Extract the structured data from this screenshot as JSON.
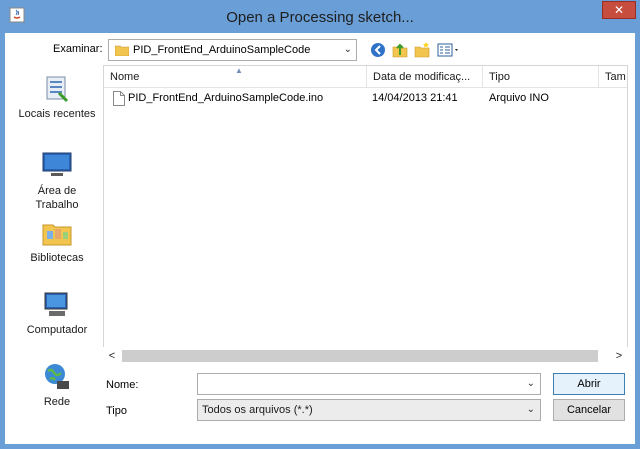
{
  "window": {
    "title": "Open a Processing sketch...",
    "close_label": "✕"
  },
  "toolbar": {
    "lookin_label": "Examinar:",
    "lookin_value": "PID_FrontEnd_ArduinoSampleCode"
  },
  "places": [
    {
      "label": "Locais recentes",
      "icon": "recent-places-icon"
    },
    {
      "label": "Área de Trabalho",
      "icon": "desktop-icon"
    },
    {
      "label": "Bibliotecas",
      "icon": "libraries-icon"
    },
    {
      "label": "Computador",
      "icon": "computer-icon"
    },
    {
      "label": "Rede",
      "icon": "network-icon"
    }
  ],
  "filelist": {
    "columns": [
      "Nome",
      "Data de modificaç...",
      "Tipo",
      "Tam"
    ],
    "rows": [
      {
        "name": "PID_FrontEnd_ArduinoSampleCode.ino",
        "modified": "14/04/2013 21:41",
        "type": "Arquivo INO"
      }
    ]
  },
  "form": {
    "name_label": "Nome:",
    "name_value": "",
    "type_label": "Tipo",
    "type_value": "Todos os arquivos (*.*)",
    "open_label": "Abrir",
    "cancel_label": "Cancelar"
  },
  "scrollbar": {
    "left_arrow": "<",
    "right_arrow": ">"
  }
}
